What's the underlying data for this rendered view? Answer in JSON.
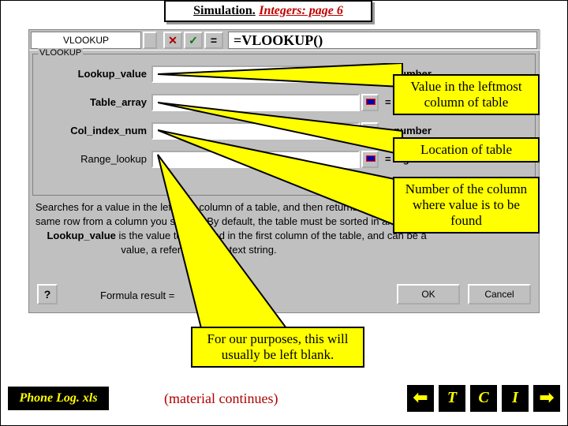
{
  "title": {
    "sim": "Simulation.",
    "page": "Integers: page 6"
  },
  "formula_bar": {
    "name": "VLOOKUP",
    "cancel_glyph": "✕",
    "confirm_glyph": "✓",
    "eq_glyph": "=",
    "formula": "=VLOOKUP()"
  },
  "fieldset_label": "VLOOKUP",
  "args": {
    "lookup_value": {
      "label": "Lookup_value",
      "hint": "= number"
    },
    "table_array": {
      "label": "Table_array",
      "hint": "= number"
    },
    "col_index": {
      "label": "Col_index_num",
      "hint": "= number"
    },
    "range_lookup": {
      "label": "Range_lookup",
      "hint": "= logical"
    }
  },
  "description": {
    "line1a": "Searches for a value in the leftmost column of a table, and then returns a value in the",
    "line1b": "same row from a column you specify. By default, the table must be sorted in an ascending",
    "line2_bold": "Lookup_value",
    "line2_rest": " is the value to be found in the first column of the table, and can be a",
    "line3": "value, a reference, or a text string."
  },
  "buttons": {
    "help": "?",
    "result_label": "Formula result =",
    "ok": "OK",
    "cancel": "Cancel"
  },
  "callouts": {
    "c1": "Value in the leftmost column of table",
    "c2": "Location of table",
    "c3": "Number of the column where value is to be found",
    "c4": "For our purposes, this will usually be left blank."
  },
  "footer": {
    "file": "Phone Log. xls",
    "continues": "(material continues)",
    "nav": {
      "back": "⬅",
      "t": "T",
      "c": "C",
      "i": "I",
      "fwd": "➡"
    }
  }
}
